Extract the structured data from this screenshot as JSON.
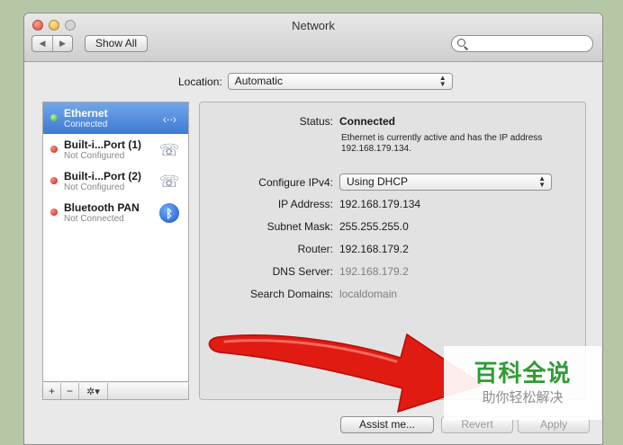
{
  "window": {
    "title": "Network"
  },
  "toolbar": {
    "back": "◀",
    "forward": "▶",
    "show_all": "Show All",
    "search_placeholder": ""
  },
  "location": {
    "label": "Location:",
    "value": "Automatic"
  },
  "services": [
    {
      "name": "Ethernet",
      "status": "Connected",
      "state": "green",
      "icon": "ethernet-icon",
      "selected": true
    },
    {
      "name": "Built-i...Port (1)",
      "status": "Not Configured",
      "state": "red",
      "icon": "phone-icon",
      "selected": false
    },
    {
      "name": "Built-i...Port (2)",
      "status": "Not Configured",
      "state": "red",
      "icon": "phone-icon",
      "selected": false
    },
    {
      "name": "Bluetooth PAN",
      "status": "Not Connected",
      "state": "red",
      "icon": "bluetooth-icon",
      "selected": false
    }
  ],
  "sidebar_tools": {
    "add": "+",
    "remove": "−",
    "gear": "✲▾"
  },
  "detail": {
    "status_label": "Status:",
    "status_value": "Connected",
    "status_desc": "Ethernet is currently active and has the IP address 192.168.179.134.",
    "configure_label": "Configure IPv4:",
    "configure_value": "Using DHCP",
    "ip_label": "IP Address:",
    "ip_value": "192.168.179.134",
    "subnet_label": "Subnet Mask:",
    "subnet_value": "255.255.255.0",
    "router_label": "Router:",
    "router_value": "192.168.179.2",
    "dns_label": "DNS Server:",
    "dns_value": "192.168.179.2",
    "search_label": "Search Domains:",
    "search_value": "localdomain"
  },
  "buttons": {
    "assist": "Assist me...",
    "revert": "Revert",
    "apply": "Apply"
  },
  "watermark": {
    "title": "百科全说",
    "subtitle": "助你轻松解决"
  },
  "colors": {
    "selection": "#3e7ad6",
    "arrow": "#e01b12",
    "brand": "#2f9c34"
  }
}
